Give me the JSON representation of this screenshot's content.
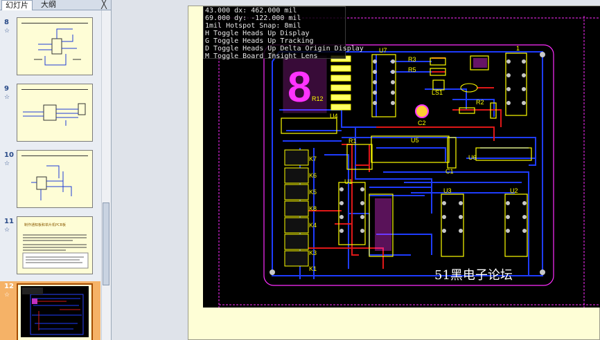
{
  "tabs": {
    "slides": "幻灯片",
    "outline": "大纲",
    "close": "╳"
  },
  "slides": [
    {
      "num": "8",
      "anim": "☆"
    },
    {
      "num": "9",
      "anim": "☆"
    },
    {
      "num": "10",
      "anim": "☆"
    },
    {
      "num": "11",
      "anim": "☆",
      "title": "制作通知板和单片机PCB板"
    },
    {
      "num": "12",
      "anim": "☆"
    }
  ],
  "hud": {
    "line1": "43.000   dx:   462.000 mil",
    "line2": "69.000   dy:  -122.000 mil",
    "line3": "1mil Hotspot Snap: 8mil",
    "line4": "H  Toggle Heads Up Display",
    "line5": "G  Toggle Heads Up Tracking",
    "line6": "D  Toggle Heads Up Delta Origin Display",
    "line7": "M  Toggle Board Insight Lens"
  },
  "watermark": "51黑电子论坛",
  "pcb_labels": {
    "u7": "U7",
    "u1": "U1",
    "u2": "U2",
    "u3": "U3",
    "u4": "U4",
    "u5": "U5",
    "u6": "U6",
    "r1": "R1",
    "r2": "R2",
    "r3": "R3",
    "r5": "R5",
    "r12": "R12",
    "c1": "C1",
    "c2": "C2",
    "ls1": "LS1",
    "j1": "1",
    "k7": "K7",
    "k6": "K6",
    "k5": "K5",
    "k8": "K8",
    "k3": "K3",
    "k1": "K1",
    "k4": "K4"
  },
  "colors": {
    "board_bg": "#000000",
    "outline": "#ff2dff",
    "top_trace": "#e01818",
    "bottom_trace": "#1e3cff",
    "silk": "#ffff00",
    "selected_thumb": "#f5b267"
  }
}
